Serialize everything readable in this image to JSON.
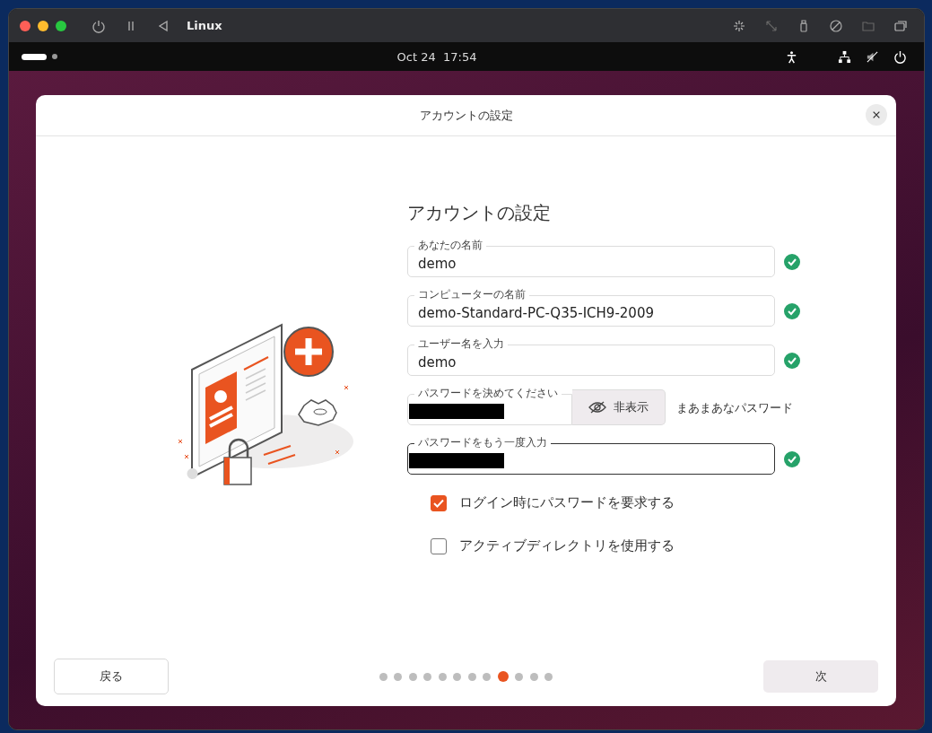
{
  "host_window": {
    "title": "Linux"
  },
  "top_bar": {
    "date": "Oct 24",
    "time": "17:54"
  },
  "dialog": {
    "title": "アカウントの設定",
    "heading": "アカウントの設定",
    "fields": [
      {
        "kind": "text",
        "label": "あなたの名前",
        "value": "demo",
        "valid": true,
        "focused": false
      },
      {
        "kind": "text",
        "label": "コンピューターの名前",
        "value": "demo-Standard-PC-Q35-ICH9-2009",
        "valid": true,
        "focused": false
      },
      {
        "kind": "text",
        "label": "ユーザー名を入力",
        "value": "demo",
        "valid": true,
        "focused": false
      },
      {
        "kind": "password",
        "label": "パスワードを決めてください",
        "toggle_label": "非表示",
        "strength": "まあまあなパスワード",
        "valid": false,
        "focused": false
      },
      {
        "kind": "password",
        "label": "パスワードをもう一度入力",
        "valid": true,
        "focused": true
      }
    ],
    "options": [
      {
        "label": "ログイン時にパスワードを要求する",
        "checked": true
      },
      {
        "label": "アクティブディレクトリを使用する",
        "checked": false
      }
    ],
    "back_button": "戻る",
    "next_button": "次",
    "steps": [
      {
        "selected": false
      },
      {
        "selected": false
      },
      {
        "selected": false
      },
      {
        "selected": false
      },
      {
        "selected": false
      },
      {
        "selected": false
      },
      {
        "selected": false
      },
      {
        "selected": false
      },
      {
        "selected": true
      },
      {
        "selected": false
      },
      {
        "selected": false
      },
      {
        "selected": false
      }
    ]
  }
}
